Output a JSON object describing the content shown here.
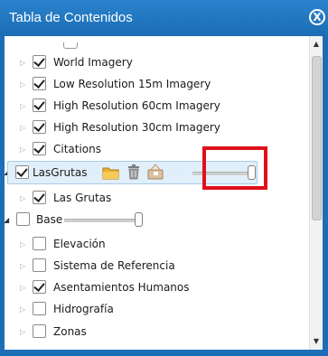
{
  "window": {
    "title": "Tabla de Contenidos",
    "close_glyph": "X"
  },
  "layers": [
    {
      "label": "World Imagery",
      "checked": true
    },
    {
      "label": "Low Resolution 15m Imagery",
      "checked": true
    },
    {
      "label": "High Resolution 60cm Imagery",
      "checked": true
    },
    {
      "label": "High Resolution 30cm Imagery",
      "checked": true
    },
    {
      "label": "Citations",
      "checked": true
    }
  ],
  "lasgrutas": {
    "label": "LasGrutas",
    "checked": true,
    "opacity": 1.0,
    "children": [
      {
        "label": "Las Grutas",
        "checked": true
      }
    ],
    "icons": [
      "folder-icon",
      "trash-icon",
      "edit-layer-icon"
    ]
  },
  "base": {
    "label": "Base",
    "checked": false,
    "opacity": 1.0,
    "children": [
      {
        "label": "Elevación",
        "checked": false
      },
      {
        "label": "Sistema de Referencia",
        "checked": false
      },
      {
        "label": "Asentamientos Humanos",
        "checked": true
      },
      {
        "label": "Hidrografía",
        "checked": false
      },
      {
        "label": "Zonas",
        "checked": false
      }
    ]
  },
  "colors": {
    "titlebar": "#1c6fb6",
    "highlight": "#e10f1b",
    "selected_row": "#e1effa"
  }
}
